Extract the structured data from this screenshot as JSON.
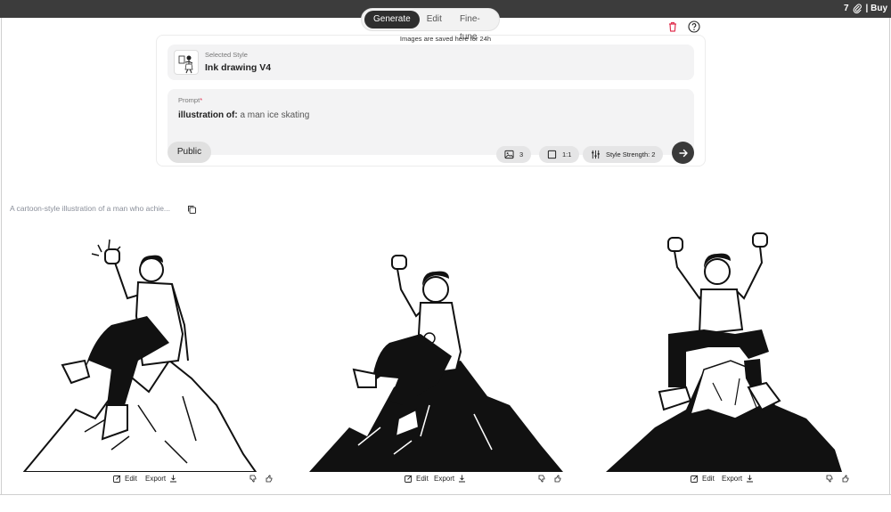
{
  "topbar": {
    "credits": "7",
    "buy_label": "| Buy"
  },
  "tabs": [
    {
      "label": "Generate",
      "active": true
    },
    {
      "label": "Edit",
      "active": false
    },
    {
      "label": "Fine-tune",
      "active": false
    }
  ],
  "saved_note": "Images are saved here for 24h",
  "style": {
    "label": "Selected Style",
    "name": "Ink drawing V4"
  },
  "prompt": {
    "label": "Prompt",
    "required_mark": "*",
    "prefix": "illustration of:",
    "text": "a man ice skating"
  },
  "controls": {
    "visibility": "Public",
    "image_count": "3",
    "aspect_ratio": "1:1",
    "style_strength": "Style Strength: 2"
  },
  "caption": "A cartoon-style illustration of a man who achie...",
  "results": [
    {
      "edit_label": "Edit",
      "export_label": "Export"
    },
    {
      "edit_label": "Edit",
      "export_label": "Export"
    },
    {
      "edit_label": "Edit",
      "export_label": "Export"
    }
  ],
  "colors": {
    "dark": "#2e2e2e",
    "panel": "#f3f3f4",
    "delete": "#e0304f",
    "caption": "#8a8f9a"
  }
}
